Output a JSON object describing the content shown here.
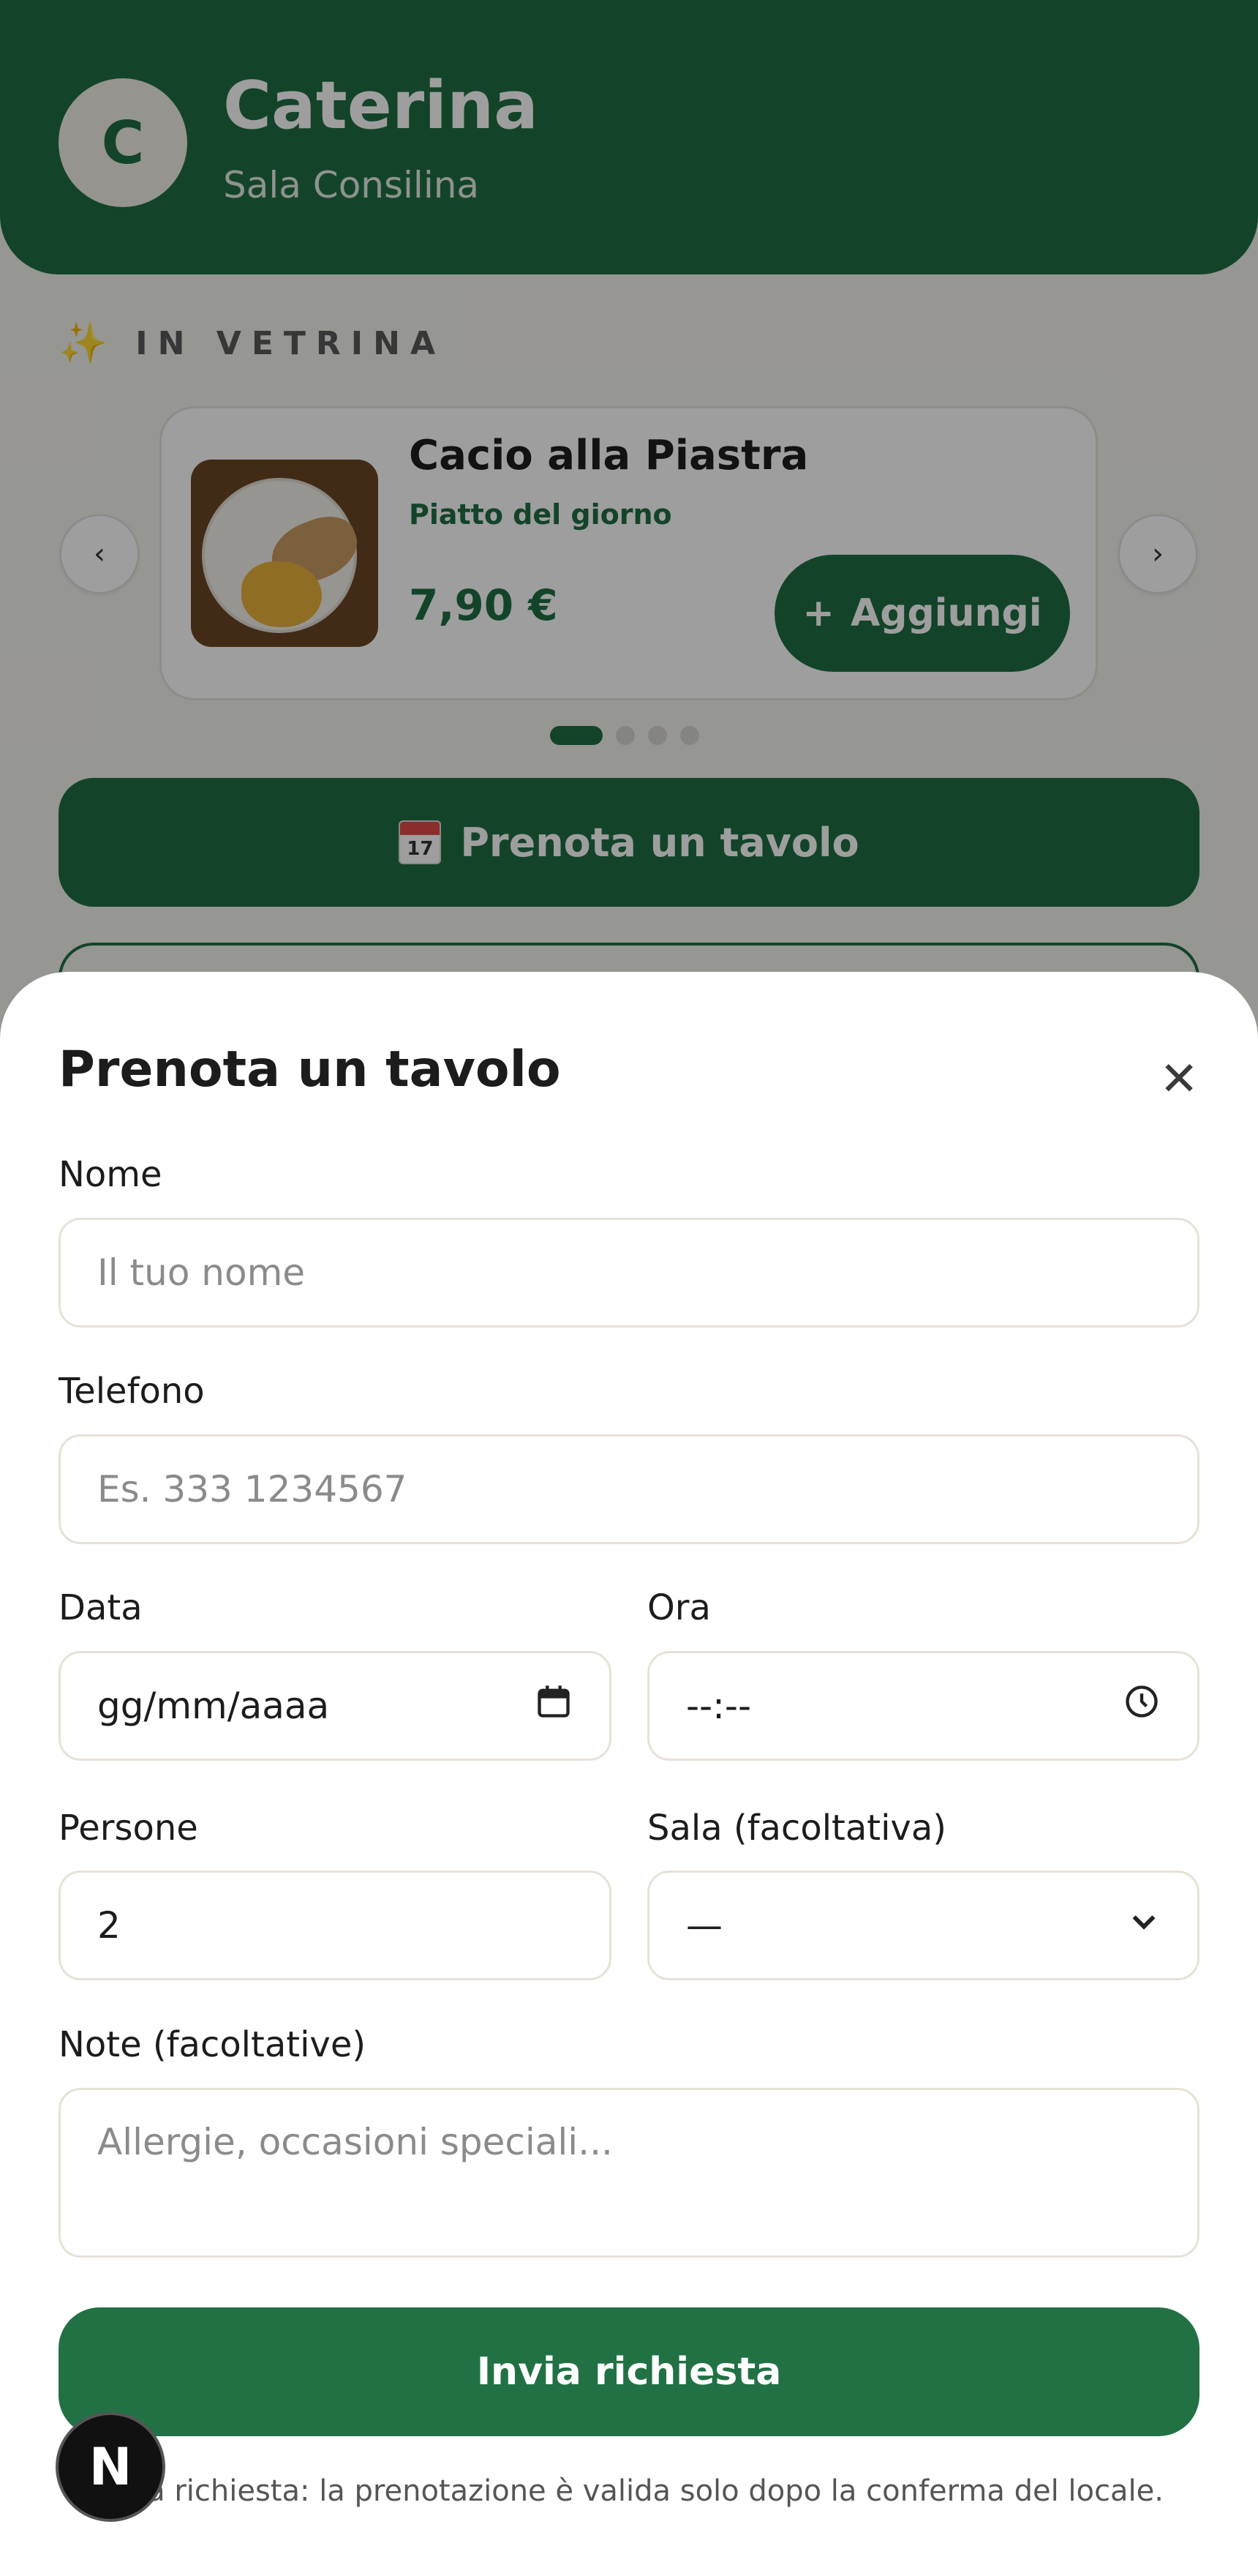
{
  "business": {
    "initial": "C",
    "name": "Caterina",
    "city": "Sala Consilina"
  },
  "featured": {
    "section_label": "IN VETRINA",
    "prev_glyph": "‹",
    "next_glyph": "›",
    "dish_name": "Cacio alla Piastra",
    "dish_tag": "Piatto del giorno",
    "price": "7,90 €",
    "add_label": "Aggiungi",
    "add_glyph": "+",
    "dots": 4,
    "active_dot": 0
  },
  "book_button": {
    "label": "Prenota un tavolo",
    "calendar_day": "17"
  },
  "sheet": {
    "title": "Prenota un tavolo",
    "close_glyph": "✕",
    "name_label": "Nome",
    "name_placeholder": "Il tuo nome",
    "phone_label": "Telefono",
    "phone_placeholder": "Es. 333 1234567",
    "date_label": "Data",
    "date_value": "gg/mm/aaaa",
    "time_label": "Ora",
    "time_value": "--:--",
    "people_label": "Persone",
    "people_value": "2",
    "room_label": "Sala (facoltativa)",
    "room_value": "—",
    "notes_label": "Note (facoltative)",
    "notes_placeholder": "Allergie, occasioni speciali...",
    "submit_label": "Invia richiesta",
    "disclaimer": "la richiesta: la prenotazione è valida solo dopo la conferma del locale."
  },
  "dev_badge": {
    "letter": "N"
  },
  "colors": {
    "brand_green": "#1f6e43",
    "submit_green": "#217145"
  }
}
